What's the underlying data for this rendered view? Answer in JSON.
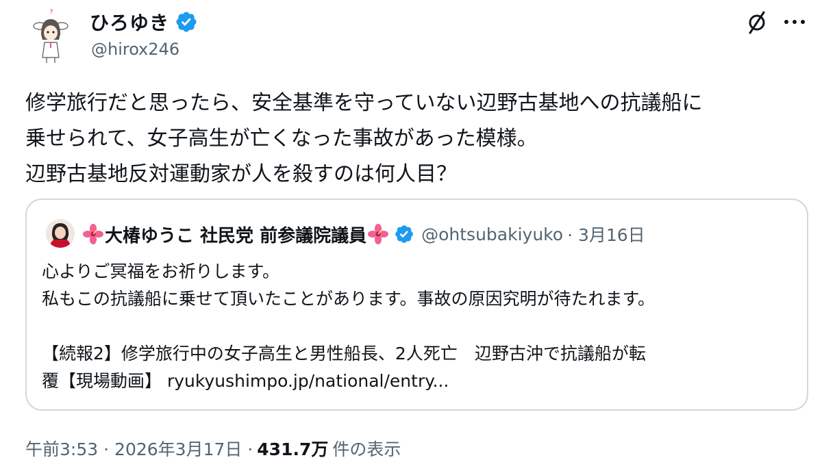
{
  "author": {
    "display_name": "ひろゆき",
    "handle": "@hirox246",
    "verified_color": "#1d9bf0"
  },
  "actions": {
    "grok_icon": "grok-icon",
    "more_icon": "more-icon"
  },
  "tweet": {
    "lines": [
      "修学旅行だと思ったら、安全基準を守っていない辺野古基地への抗議船に",
      "乗せられて、女子高生が亡くなった事故があった模様。",
      "辺野古基地反対運動家が人を殺すのは何人目？"
    ]
  },
  "quote": {
    "display_name": "大椿ゆうこ 社民党 前参議院議員",
    "handle": "@ohtsubakiyuko",
    "date": "· 3月16日",
    "lines": [
      "心よりご冥福をお祈りします。",
      "私もこの抗議船に乗せて頂いたことがあります。事故の原因究明が待たれます。",
      "",
      "【続報2】修学旅行中の女子高生と男性船長、2人死亡　辺野古沖で抗議船が転",
      "覆【現場動画】 ryukyushimpo.jp/national/entry..."
    ]
  },
  "meta": {
    "time": "午前3:53",
    "date": "· 2026年3月17日 ·",
    "views": "431.7万",
    "views_label": "件の表示"
  }
}
